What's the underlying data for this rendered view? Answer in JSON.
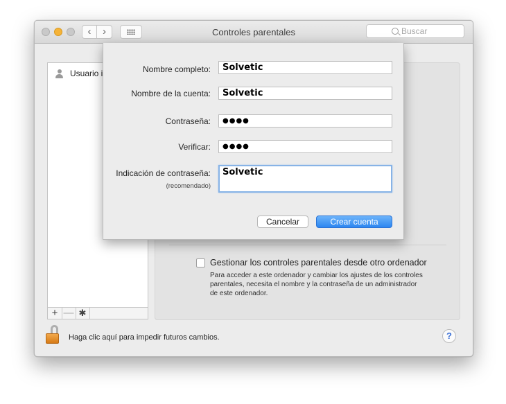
{
  "window": {
    "title": "Controles parentales",
    "search_placeholder": "Buscar",
    "nav_back": "‹",
    "nav_forward": "›"
  },
  "sidebar": {
    "users": [
      {
        "label": "Usuario ir"
      }
    ],
    "toolbar": {
      "add": "+",
      "remove": "—",
      "gear": "✱"
    }
  },
  "panel": {
    "checkbox_label": "Gestionar los controles parentales desde otro ordenador",
    "checkbox_checked": false,
    "checkbox_description": "Para acceder a este ordenador y cambiar los ajustes de los controles parentales, necesita el nombre y la contraseña de un administrador de este ordenador."
  },
  "footer": {
    "lock_text": "Haga clic aquí para impedir futuros cambios.",
    "help": "?"
  },
  "sheet": {
    "full_name_label": "Nombre completo:",
    "full_name_value": "Solvetic",
    "account_name_label": "Nombre de la cuenta:",
    "account_name_value": "Solvetic",
    "password_label": "Contraseña:",
    "password_value": "●●●●",
    "verify_label": "Verificar:",
    "verify_value": "●●●●",
    "hint_label": "Indicación de contraseña:",
    "hint_sublabel": "(recomendado)",
    "hint_value": "Solvetic",
    "cancel_label": "Cancelar",
    "create_label": "Crear cuenta"
  },
  "colors": {
    "accent": "#2c86f0",
    "minimize": "#f5b338",
    "lock": "#e08a24"
  }
}
